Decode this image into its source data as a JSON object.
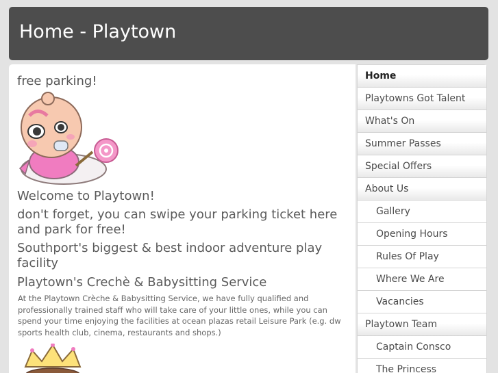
{
  "header": {
    "title": "Home - Playtown"
  },
  "main": {
    "tagline": "free parking!",
    "welcome": "Welcome to Playtown!",
    "parking": "don't forget, you can swipe your parking ticket here and park for free!",
    "biggest": "Southport's biggest & best indoor adventure play facility",
    "creche_heading": "Playtown's Crechè & Babysitting Service",
    "creche_text": "At the Playtown Crèche & Babysitting Service, we have fully qualified and professionally trained staff who will take care of your little ones, while you can spend your time enjoying the facilities at ocean plazas retail Leisure Park (e.g. dw sports health club, cinema, restaurants and shops.)"
  },
  "sidebar": {
    "items": [
      {
        "label": "Home",
        "level": "top",
        "active": true
      },
      {
        "label": "Playtowns Got Talent",
        "level": "top"
      },
      {
        "label": "What's On",
        "level": "top"
      },
      {
        "label": "Summer Passes",
        "level": "top"
      },
      {
        "label": "Special Offers",
        "level": "top"
      },
      {
        "label": "About Us",
        "level": "top"
      },
      {
        "label": "Gallery",
        "level": "sub"
      },
      {
        "label": "Opening Hours",
        "level": "sub"
      },
      {
        "label": "Rules Of Play",
        "level": "sub"
      },
      {
        "label": "Where We Are",
        "level": "sub"
      },
      {
        "label": "Vacancies",
        "level": "sub"
      },
      {
        "label": "Playtown Team",
        "level": "top"
      },
      {
        "label": "Captain Consco",
        "level": "sub"
      },
      {
        "label": "The Princess",
        "level": "sub"
      }
    ]
  },
  "colors": {
    "header_bg": "#4d4d4d",
    "page_bg": "#e3e3e3",
    "baby_pink": "#f07cc0"
  }
}
